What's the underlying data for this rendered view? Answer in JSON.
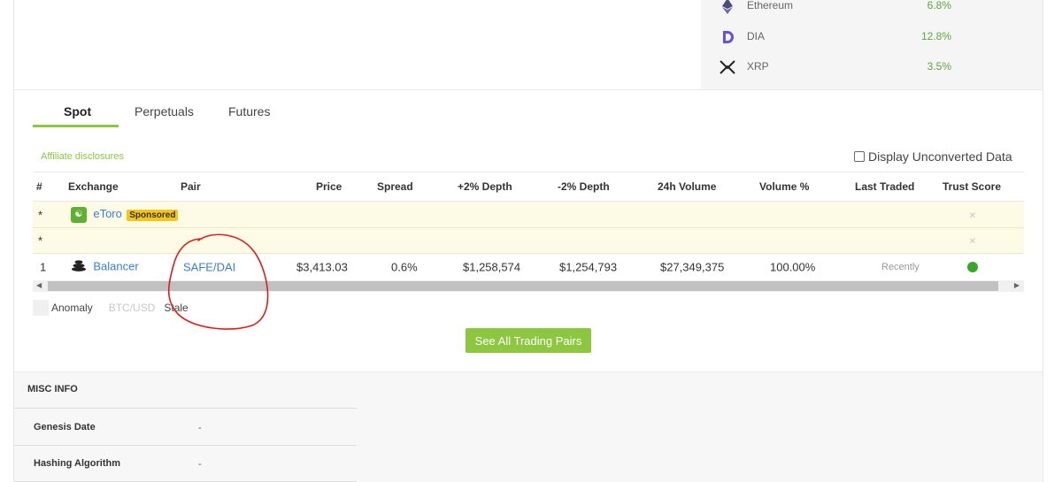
{
  "coins": [
    {
      "name": "Ethereum",
      "pct": "6.8%",
      "icon": "ethereum-icon"
    },
    {
      "name": "DIA",
      "pct": "12.8%",
      "icon": "dia-icon"
    },
    {
      "name": "XRP",
      "pct": "3.5%",
      "icon": "xrp-icon"
    }
  ],
  "tabs": [
    "Spot",
    "Perpetuals",
    "Futures"
  ],
  "affiliate_label": "Affiliate disclosures",
  "unconverted_label": "Display Unconverted Data",
  "columns": [
    "#",
    "Exchange",
    "Pair",
    "Price",
    "Spread",
    "+2% Depth",
    "-2% Depth",
    "24h Volume",
    "Volume %",
    "Last Traded",
    "Trust Score"
  ],
  "sponsored_rows": [
    {
      "rank": "*",
      "exchange": "eToro",
      "badge": "Sponsored",
      "trust": "×"
    },
    {
      "rank": "*",
      "trust": "×"
    }
  ],
  "rows": [
    {
      "rank": "1",
      "exchange": "Balancer",
      "pair": "SAFE/DAI",
      "price": "$3,413.03",
      "spread": "0.6%",
      "depth_plus": "$1,258,574",
      "depth_minus": "$1,254,793",
      "volume_24h": "$27,349,375",
      "volume_pct": "100.00%",
      "last_traded": "Recently",
      "trust_color": "#3aa726"
    }
  ],
  "legend": {
    "anomaly": "Anomaly",
    "btc": "BTC/USD",
    "stale": "Stale"
  },
  "cta_label": "See All Trading Pairs",
  "misc": {
    "title": "MISC INFO",
    "items": [
      {
        "label": "Genesis Date",
        "value": "-"
      },
      {
        "label": "Hashing Algorithm",
        "value": "-"
      }
    ]
  },
  "colors": {
    "accent": "#8dc63f",
    "link": "#3b7ed0",
    "positive": "#5ea63a",
    "annotation": "#e01b1b"
  }
}
